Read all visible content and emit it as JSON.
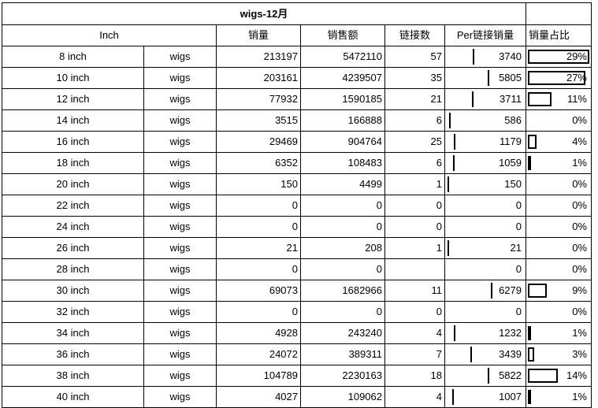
{
  "title": "wigs-12月",
  "headers": {
    "inch": "Inch",
    "sales_qty": "销量",
    "sales_amount": "销售额",
    "links": "链接数",
    "per_link": "Per链接销量",
    "share": "销量占比"
  },
  "rows": [
    {
      "inch": "8 inch",
      "type": "wigs",
      "qty": "213197",
      "amount": "5472110",
      "links": "57",
      "per": "3740",
      "share": "29%"
    },
    {
      "inch": "10 inch",
      "type": "wigs",
      "qty": "203161",
      "amount": "4239507",
      "links": "35",
      "per": "5805",
      "share": "27%"
    },
    {
      "inch": "12 inch",
      "type": "wigs",
      "qty": "77932",
      "amount": "1590185",
      "links": "21",
      "per": "3711",
      "share": "11%"
    },
    {
      "inch": "14 inch",
      "type": "wigs",
      "qty": "3515",
      "amount": "166888",
      "links": "6",
      "per": "586",
      "share": "0%"
    },
    {
      "inch": "16 inch",
      "type": "wigs",
      "qty": "29469",
      "amount": "904764",
      "links": "25",
      "per": "1179",
      "share": "4%"
    },
    {
      "inch": "18 inch",
      "type": "wigs",
      "qty": "6352",
      "amount": "108483",
      "links": "6",
      "per": "1059",
      "share": "1%"
    },
    {
      "inch": "20 inch",
      "type": "wigs",
      "qty": "150",
      "amount": "4499",
      "links": "1",
      "per": "150",
      "share": "0%"
    },
    {
      "inch": "22 inch",
      "type": "wigs",
      "qty": "0",
      "amount": "0",
      "links": "0",
      "per": "0",
      "share": "0%"
    },
    {
      "inch": "24 inch",
      "type": "wigs",
      "qty": "0",
      "amount": "0",
      "links": "0",
      "per": "0",
      "share": "0%"
    },
    {
      "inch": "26 inch",
      "type": "wigs",
      "qty": "21",
      "amount": "208",
      "links": "1",
      "per": "21",
      "share": "0%"
    },
    {
      "inch": "28 inch",
      "type": "wigs",
      "qty": "0",
      "amount": "0",
      "links": "",
      "per": "0",
      "share": "0%"
    },
    {
      "inch": "30 inch",
      "type": "wigs",
      "qty": "69073",
      "amount": "1682966",
      "links": "11",
      "per": "6279",
      "share": "9%"
    },
    {
      "inch": "32 inch",
      "type": "wigs",
      "qty": "0",
      "amount": "0",
      "links": "0",
      "per": "0",
      "share": "0%"
    },
    {
      "inch": "34 inch",
      "type": "wigs",
      "qty": "4928",
      "amount": "243240",
      "links": "4",
      "per": "1232",
      "share": "1%"
    },
    {
      "inch": "36 inch",
      "type": "wigs",
      "qty": "24072",
      "amount": "389311",
      "links": "7",
      "per": "3439",
      "share": "3%"
    },
    {
      "inch": "38 inch",
      "type": "wigs",
      "qty": "104789",
      "amount": "2230163",
      "links": "18",
      "per": "5822",
      "share": "14%"
    },
    {
      "inch": "40 inch",
      "type": "wigs",
      "qty": "4027",
      "amount": "109062",
      "links": "4",
      "per": "1007",
      "share": "1%"
    }
  ],
  "scales": {
    "per_max": 6279,
    "share_max": 29
  }
}
